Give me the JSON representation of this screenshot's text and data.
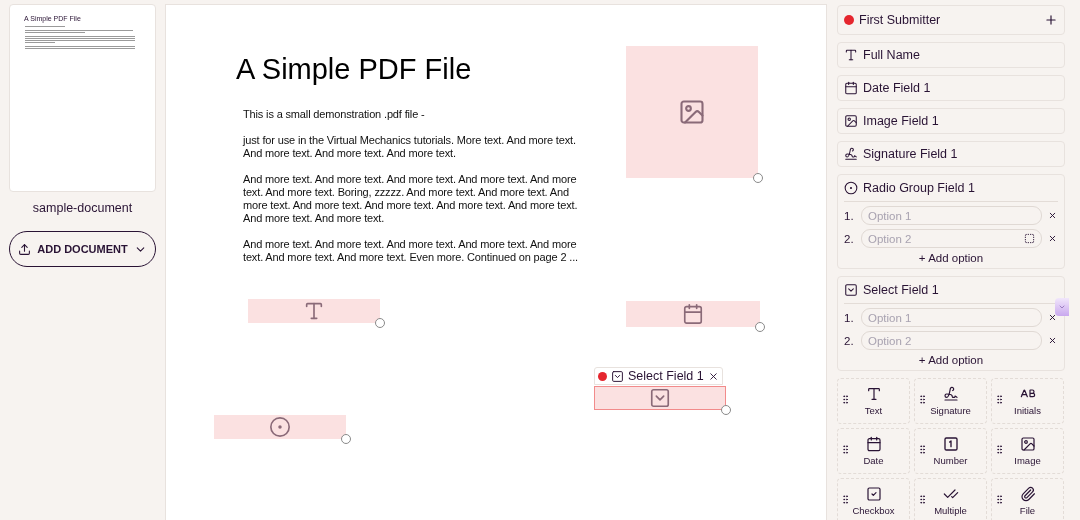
{
  "documents": [
    {
      "name": "sample-document",
      "thumbnail_title": "A Simple PDF File"
    }
  ],
  "add_document_button": "ADD DOCUMENT",
  "page": {
    "title": "A Simple PDF File",
    "paragraphs": [
      "This is a small demonstration .pdf file -",
      "just for use in the Virtual Mechanics tutorials. More text. And more text. And more text. And more text. And more text.",
      "And more text. And more text. And more text. And more text. And more text. And more text. Boring, zzzzz. And more text. And more text. And more text. And more text. And more text. And more text. And more text. And more text. And more text.",
      "And more text. And more text. And more text. And more text. And more text. And more text. And more text. Even more. Continued on page 2 ..."
    ]
  },
  "placed_fields": [
    {
      "kind": "image",
      "selected": false
    },
    {
      "kind": "text",
      "selected": false
    },
    {
      "kind": "date",
      "selected": false
    },
    {
      "kind": "select",
      "selected": true,
      "label": "Select Field 1"
    },
    {
      "kind": "radio",
      "selected": false
    }
  ],
  "submitter": {
    "name": "First Submitter",
    "color": "#e5262e"
  },
  "fields": [
    {
      "kind": "text",
      "name": "Full Name"
    },
    {
      "kind": "date",
      "name": "Date Field 1"
    },
    {
      "kind": "image",
      "name": "Image Field 1"
    },
    {
      "kind": "signature",
      "name": "Signature Field 1"
    },
    {
      "kind": "radio",
      "name": "Radio Group Field 1",
      "options": [
        {
          "number": "1.",
          "placeholder": "Option 1",
          "hovered": false
        },
        {
          "number": "2.",
          "placeholder": "Option 2",
          "hovered": true
        }
      ],
      "add_option": "+ Add option"
    },
    {
      "kind": "select",
      "name": "Select Field 1",
      "options": [
        {
          "number": "1.",
          "placeholder": "Option 1",
          "hovered": false
        },
        {
          "number": "2.",
          "placeholder": "Option 2",
          "hovered": false
        }
      ],
      "add_option": "+ Add option"
    }
  ],
  "palette": [
    {
      "kind": "text",
      "label": "Text"
    },
    {
      "kind": "signature",
      "label": "Signature"
    },
    {
      "kind": "initials",
      "label": "Initials"
    },
    {
      "kind": "date",
      "label": "Date"
    },
    {
      "kind": "number",
      "label": "Number"
    },
    {
      "kind": "image",
      "label": "Image"
    },
    {
      "kind": "checkbox",
      "label": "Checkbox"
    },
    {
      "kind": "multiple",
      "label": "Multiple"
    },
    {
      "kind": "file",
      "label": "File"
    }
  ]
}
